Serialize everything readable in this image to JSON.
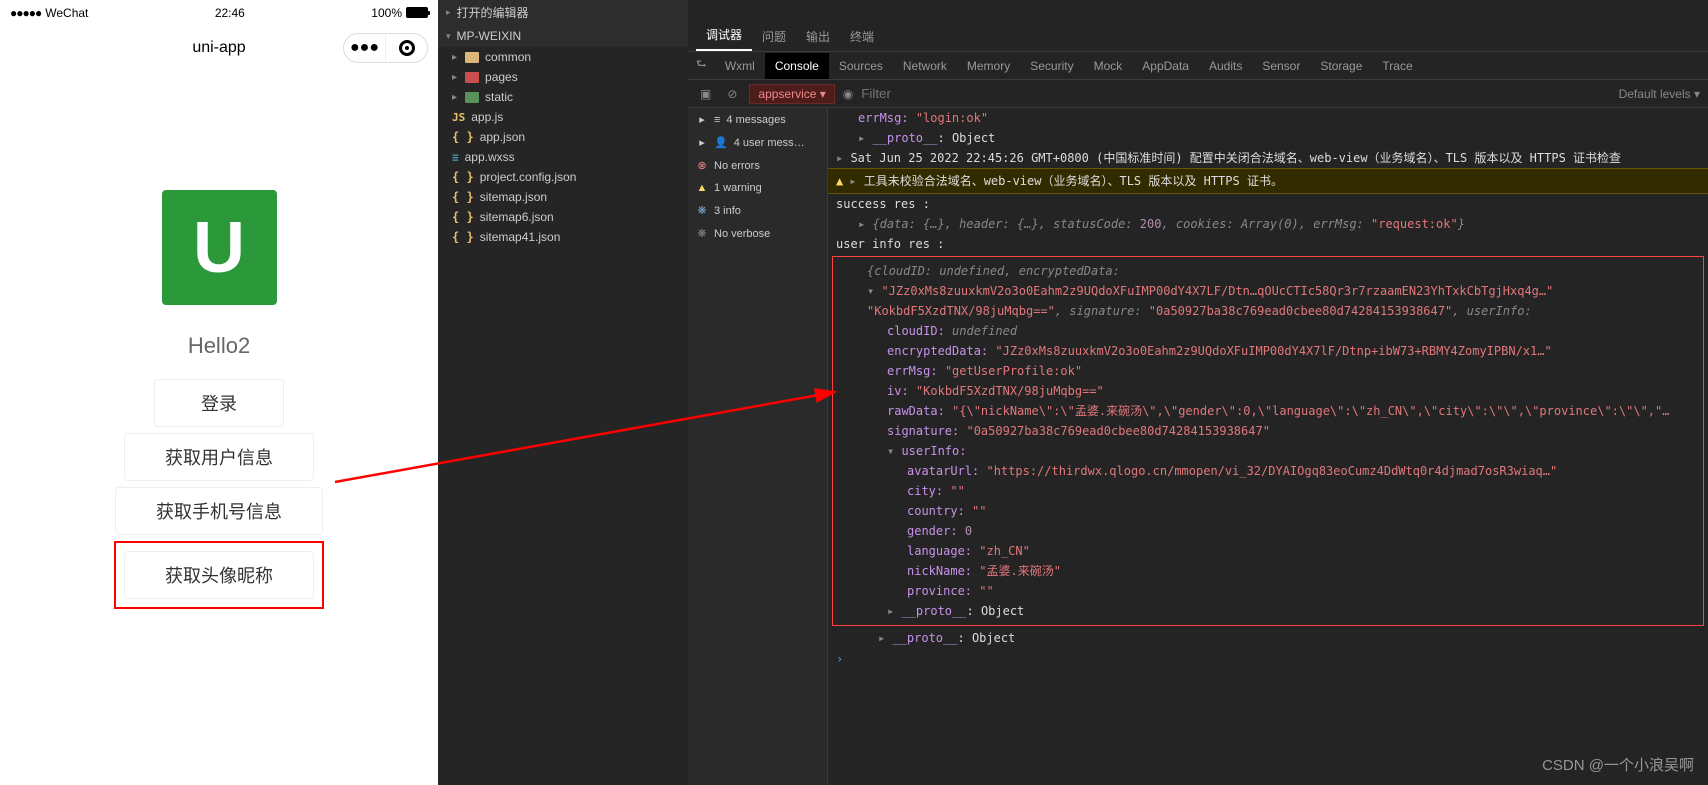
{
  "phone": {
    "carrier": "WeChat",
    "time": "22:46",
    "battery": "100%",
    "title": "uni-app",
    "logo_letter": "U",
    "hello": "Hello2",
    "buttons": {
      "login": "登录",
      "user_info": "获取用户信息",
      "phone_num": "获取手机号信息",
      "avatar_nick": "获取头像昵称"
    }
  },
  "explorer": {
    "opened_editors": "打开的编辑器",
    "project": "MP-WEIXIN",
    "folders": {
      "common": "common",
      "pages": "pages",
      "static": "static"
    },
    "files": {
      "app_js": "app.js",
      "app_json": "app.json",
      "app_wxss": "app.wxss",
      "project_config": "project.config.json",
      "sitemap": "sitemap.json",
      "sitemap6": "sitemap6.json",
      "sitemap41": "sitemap41.json"
    }
  },
  "devtools": {
    "tabs1": {
      "debugger": "调试器",
      "problems": "问题",
      "output": "输出",
      "terminal": "终端"
    },
    "tabs2": {
      "wxml": "Wxml",
      "console": "Console",
      "sources": "Sources",
      "network": "Network",
      "memory": "Memory",
      "security": "Security",
      "mock": "Mock",
      "appdata": "AppData",
      "audits": "Audits",
      "sensor": "Sensor",
      "storage": "Storage",
      "trace": "Trace"
    },
    "context": "appservice",
    "filter_placeholder": "Filter",
    "levels": "Default levels ▾",
    "sidebar": {
      "messages": "4 messages",
      "user_msgs": "4 user mess…",
      "no_errors": "No errors",
      "warnings": "1 warning",
      "info": "3 info",
      "no_verbose": "No verbose"
    },
    "console": {
      "errMsg_login": "\"login:ok\"",
      "proto": "__proto__",
      "object": "Object",
      "time_header": "Sat Jun 25 2022 22:45:26 GMT+0800 (中国标准时间) 配置中关闭合法域名、web-view（业务域名）、TLS 版本以及 HTTPS 证书检查",
      "warn_text": "工具未校验合法域名、web-view（业务域名）、TLS 版本以及 HTTPS 证书。",
      "success_res": "success res :",
      "data_hdr": "{data: {…}, header: {…}, statusCode: 200, cookies: Array(0), errMsg: \"request:ok\"}",
      "user_info_res": "user info res :",
      "obj_head": "{cloudID: undefined, encryptedData:",
      "enc_line1": "\"JZz0xMs8zuuxkmV2o3o0Eahm2z9UQdoXFuIMP00dY4X7LF/Dtn…qOUcCTIc58Qr3r7rzaamEN23YhTxkCbTgjHxq4g…\"",
      "enc_line2": "\"KokbdF5XzdTNX/98juMqbg==\", signature: \"0a50927ba38c769ead0cbee80d74284153938647\", userInfo:",
      "cloudID_k": "cloudID:",
      "cloudID_v": "undefined",
      "encryptedData_k": "encryptedData:",
      "encryptedData_v": "\"JZz0xMs8zuuxkmV2o3o0Eahm2z9UQdoXFuIMP00dY4X7lF/Dtnp+ibW73+RBMY4ZomyIPBN/x1…\"",
      "errMsg_k": "errMsg:",
      "errMsg_v": "\"getUserProfile:ok\"",
      "iv_k": "iv:",
      "iv_v": "\"KokbdF5XzdTNX/98juMqbg==\"",
      "rawData_k": "rawData:",
      "rawData_v": "\"{\\\"nickName\\\":\\\"孟婆.来碗汤\\\",\\\"gender\\\":0,\\\"language\\\":\\\"zh_CN\\\",\\\"city\\\":\\\"\\\",\\\"province\\\":\\\"\\\",\"…",
      "signature_k": "signature:",
      "signature_v": "\"0a50927ba38c769ead0cbee80d74284153938647\"",
      "userInfo_k": "userInfo:",
      "avatarUrl_k": "avatarUrl:",
      "avatarUrl_v": "\"https://thirdwx.qlogo.cn/mmopen/vi_32/DYAIOgq83eoCumz4DdWtq0r4djmad7osR3wiaq…\"",
      "city_k": "city:",
      "city_v": "\"\"",
      "country_k": "country:",
      "country_v": "\"\"",
      "gender_k": "gender:",
      "gender_v": "0",
      "language_k": "language:",
      "language_v": "\"zh_CN\"",
      "nickName_k": "nickName:",
      "nickName_v": "\"孟婆.来碗汤\"",
      "province_k": "province:",
      "province_v": "\"\""
    }
  },
  "watermark": "CSDN @一个小浪吴啊"
}
